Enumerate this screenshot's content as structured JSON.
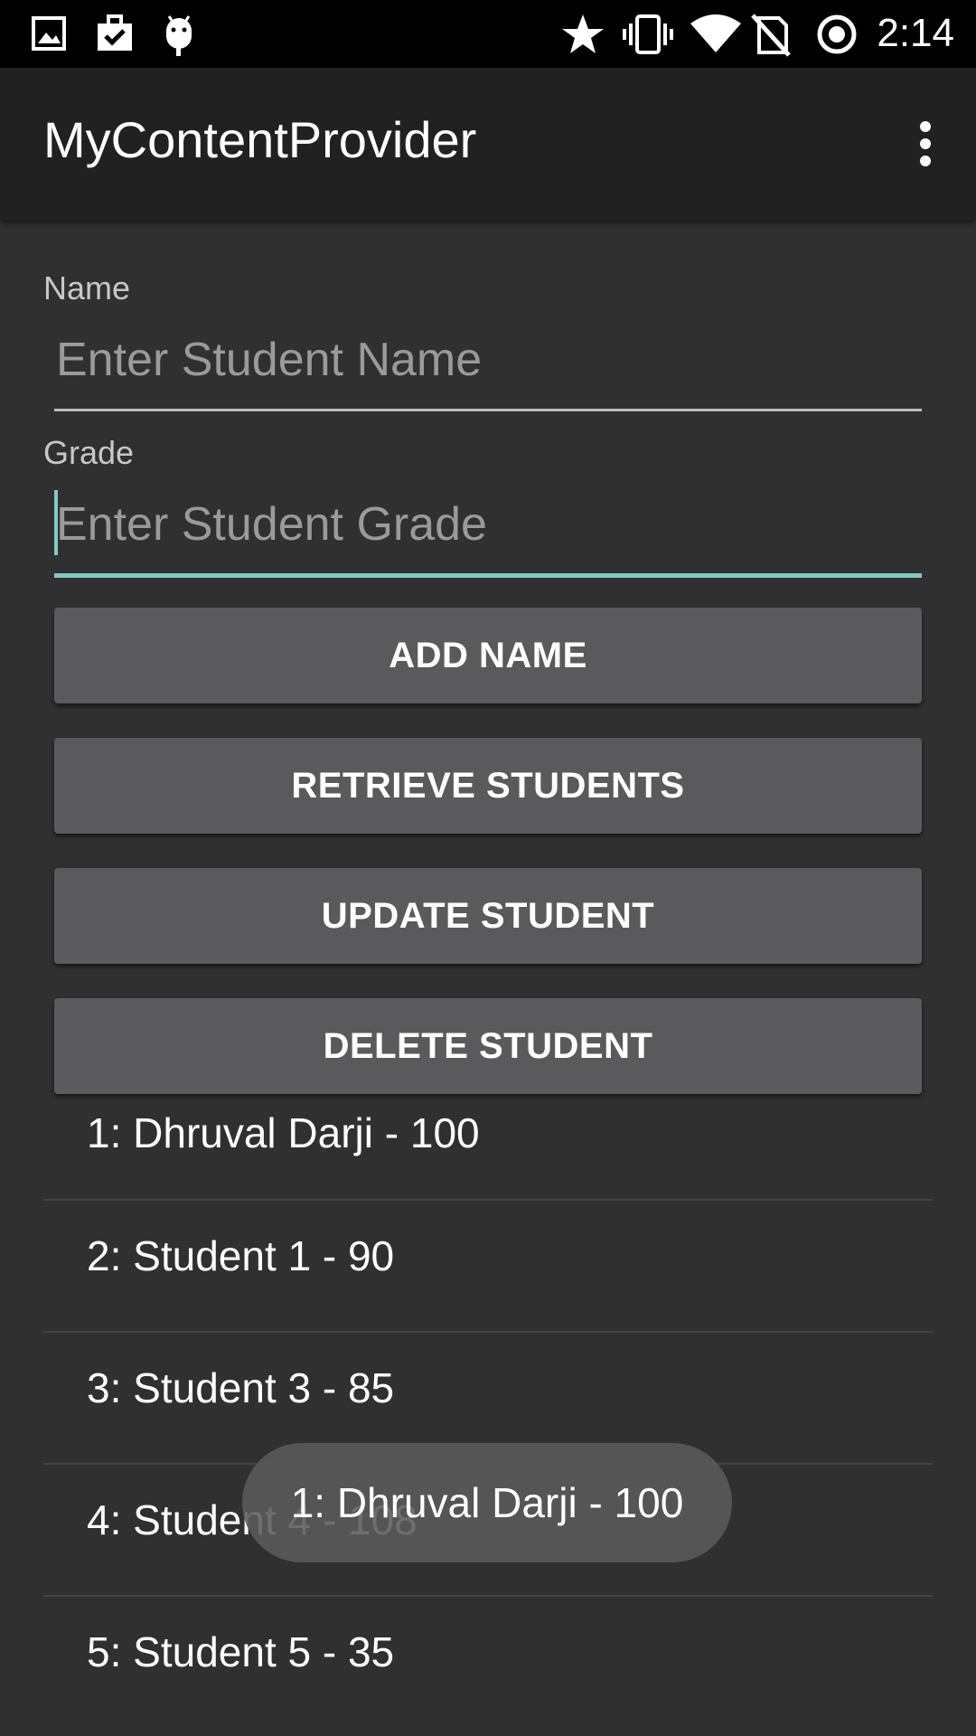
{
  "status_bar": {
    "time": "2:14",
    "icons": [
      "image-icon",
      "clipboard-check-icon",
      "android-debug-icon",
      "star-icon",
      "vibrate-icon",
      "wifi-icon",
      "no-sim-icon",
      "sync-circle-icon"
    ]
  },
  "app_bar": {
    "title": "MyContentProvider",
    "overflow_icon": "more-vert-icon"
  },
  "form": {
    "name_label": "Name",
    "name_placeholder": "Enter Student Name",
    "name_value": "",
    "grade_label": "Grade",
    "grade_placeholder": "Enter Student Grade",
    "grade_value": "",
    "accent_color": "#80cbc4"
  },
  "buttons": {
    "add": "ADD NAME",
    "retrieve": "RETRIEVE STUDENTS",
    "update": "UPDATE STUDENT",
    "delete": "DELETE STUDENT"
  },
  "students": [
    "1: Dhruval Darji - 100",
    "2: Student 1 - 90",
    "3: Student 3 - 85",
    "4: Student 4 - 108",
    "5: Student 5 - 35"
  ],
  "toast": {
    "message": "1: Dhruval Darji - 100"
  },
  "colors": {
    "background": "#303030",
    "app_bar": "#212121",
    "status_bar": "#000000",
    "button": "#5a5a5c"
  }
}
